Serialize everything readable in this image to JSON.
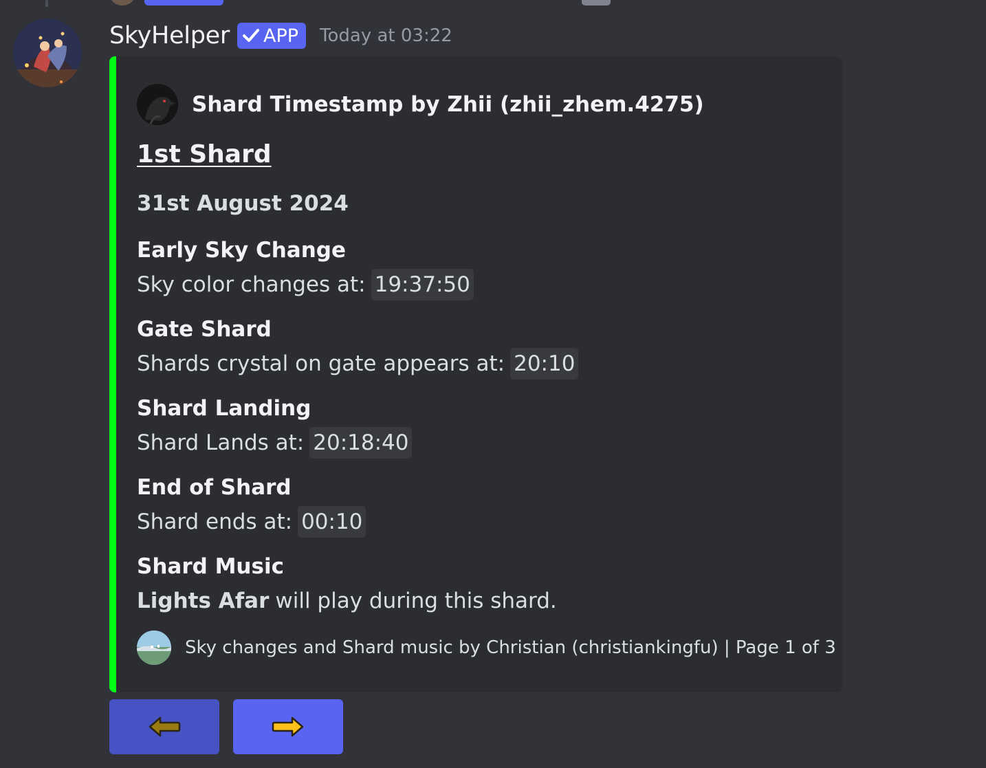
{
  "message": {
    "username": "SkyHelper",
    "app_badge": "APP",
    "timestamp": "Today at 03:22",
    "avatar_icon": "bot-avatar-icon"
  },
  "embed": {
    "accent_color": "#00ff15",
    "author": "Shard Timestamp by Zhii (zhii_zhem.4275)",
    "title": "1st Shard",
    "date": "31st August 2024",
    "fields": [
      {
        "name": "Early Sky Change",
        "value_prefix": "Sky color changes at:",
        "code": "19:37:50"
      },
      {
        "name": "Gate Shard",
        "value_prefix": "Shards crystal on gate appears at:",
        "code": "20:10"
      },
      {
        "name": "Shard Landing",
        "value_prefix": "Shard Lands at:",
        "code": "20:18:40"
      },
      {
        "name": "End of Shard",
        "value_prefix": "Shard ends at:",
        "code": "00:10"
      }
    ],
    "music": {
      "name": "Shard Music",
      "track": "Lights Afar",
      "suffix": "will play during this shard."
    },
    "footer": "Sky changes and Shard music by Christian (christiankingfu) | Page 1 of 3"
  },
  "buttons": {
    "prev_icon": "arrow-left-icon",
    "next_icon": "arrow-right-icon",
    "prev_color": "#4752c4",
    "next_color": "#5865f2"
  }
}
